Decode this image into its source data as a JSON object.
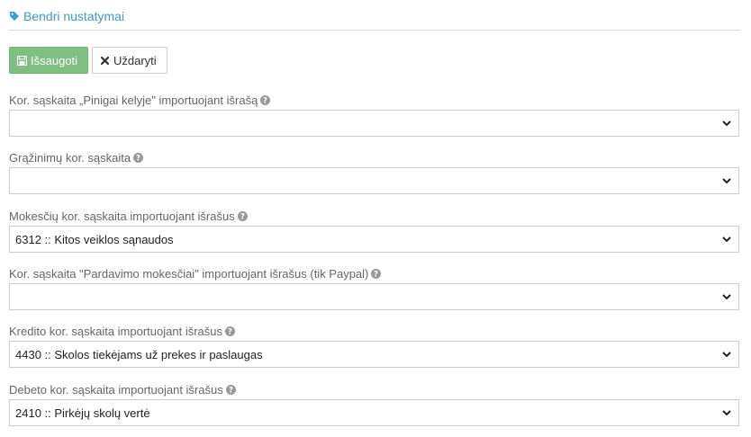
{
  "section": {
    "title": "Bendri nustatymai"
  },
  "toolbar": {
    "save_label": "Išsaugoti",
    "close_label": "Uždaryti"
  },
  "fields": [
    {
      "label": "Kor. sąskaita „Pinigai kelyje\" importuojant išrašą",
      "value": ""
    },
    {
      "label": "Grąžinimų kor. sąskaita",
      "value": ""
    },
    {
      "label": "Mokesčių kor. sąskaita importuojant išrašus",
      "value": "6312 :: Kitos veiklos sąnaudos"
    },
    {
      "label": "Kor. sąskaita \"Pardavimo mokesčiai\" importuojant išrašus (tik Paypal)",
      "value": ""
    },
    {
      "label": "Kredito kor. sąskaita importuojant išrašus",
      "value": "4430 :: Skolos tiekėjams už prekes ir paslaugas"
    },
    {
      "label": "Debeto kor. sąskaita importuojant išrašus",
      "value": "2410 :: Pirkėjų skolų vertė"
    }
  ],
  "icons": {
    "section": "tag-icon",
    "save": "floppy-disk-icon",
    "close": "close-icon",
    "help": "question-circle-icon",
    "select": "chevron-down-icon"
  },
  "colors": {
    "accent": "#3a9bd5",
    "save_button": "#7fbf7f"
  }
}
